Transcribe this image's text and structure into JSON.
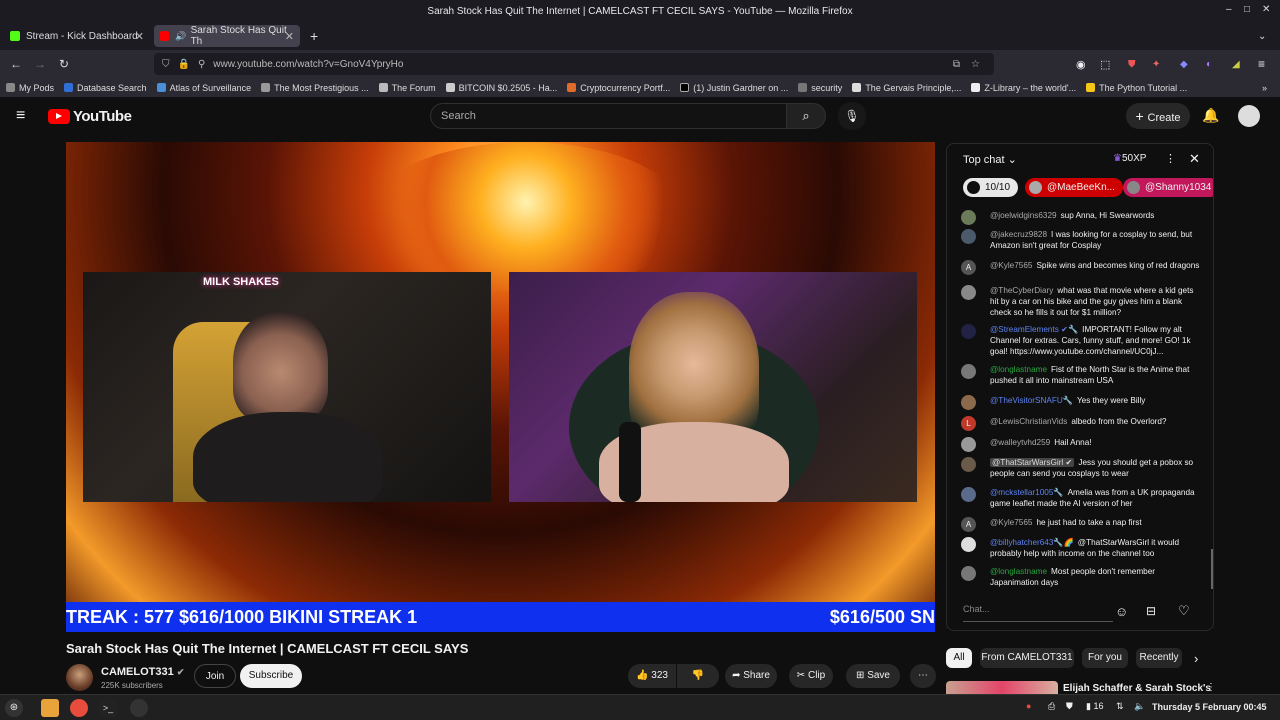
{
  "window": {
    "title": "Sarah Stock Has Quit The Internet | CAMELCAST FT CECIL SAYS - YouTube — Mozilla Firefox"
  },
  "tabs": [
    {
      "label": "Stream - Kick Dashboard",
      "fav_color": "#53fc18"
    },
    {
      "label": "Sarah Stock Has Quit Th",
      "fav_color": "#ff0000"
    }
  ],
  "nav": {
    "url": "www.youtube.com/watch?v=GnoV4YpryHo"
  },
  "bookmarks": [
    {
      "label": "My Pods",
      "color": "#888"
    },
    {
      "label": "Database Search",
      "color": "#2f6fd6"
    },
    {
      "label": "Atlas of Surveillance",
      "color": "#4a90d9"
    },
    {
      "label": "The Most Prestigious ...",
      "color": "#999"
    },
    {
      "label": "The Forum",
      "color": "#bbb"
    },
    {
      "label": "BITCOIN $0.2505 - Ha...",
      "color": "#ccc"
    },
    {
      "label": "Cryptocurrency Portf...",
      "color": "#e06b2a"
    },
    {
      "label": "(1) Justin Gardner on ...",
      "color": "#000"
    },
    {
      "label": "security",
      "color": "#777"
    },
    {
      "label": "The Gervais Principle,...",
      "color": "#ddd"
    },
    {
      "label": "Z-Library – the world'...",
      "color": "#eee"
    },
    {
      "label": "The Python Tutorial ...",
      "color": "#f5c518"
    }
  ],
  "youtube": {
    "logo_text": "YouTube",
    "search_placeholder": "Search",
    "create_label": "Create"
  },
  "video": {
    "ticker_left": "TREAK : 577 $616/1000 BIKINI STREAK 1",
    "ticker_right": "$616/500 SN",
    "cam1_sign": "MILK SHAKES",
    "title": "Sarah Stock Has Quit The Internet | CAMELCAST FT CECIL SAYS"
  },
  "channel": {
    "name": "CAMELOT331",
    "subscribers": "225K subscribers",
    "join_label": "Join",
    "subscribe_label": "Subscribe",
    "likes": "323",
    "share_label": "Share",
    "clip_label": "Clip",
    "save_label": "Save"
  },
  "chat": {
    "header": "Top chat",
    "xp": "50XP",
    "counter": "10/10",
    "pinned": [
      {
        "name": "@MaeBeeKn...",
        "color": "#cc0000"
      },
      {
        "name": "@Shanny1034",
        "color": "#c2185b"
      }
    ],
    "messages": [
      {
        "author": "@joelwidgins6329",
        "text": "sup Anna, Hi Swearwords",
        "type": "normal",
        "av": "#6b7b5a"
      },
      {
        "author": "@jakecruz9828",
        "text": "I was looking for a cosplay to send, but Amazon isn't great for Cosplay",
        "type": "normal",
        "av": "#4a5a6a"
      },
      {
        "author": "@Kyle7565",
        "text": "Spike wins and becomes king of red dragons",
        "type": "normal",
        "av": "#555555",
        "initial": "A"
      },
      {
        "author": "@TheCyberDiary",
        "text": "what was that movie where a kid gets hit by a car on his bike and the guy gives him a blank check so he fills it out for $1 million?",
        "type": "normal",
        "av": "#888888"
      },
      {
        "author": "@StreamElements ✔🔧",
        "text": "IMPORTANT! Follow my alt Channel for extras. Cars, funny stuff, and more! GO! 1k goal! https://www.youtube.com/channel/UC0jJ...",
        "type": "mod",
        "av": "#222244"
      },
      {
        "author": "@longlastname",
        "text": "Fist of the North Star is the Anime that pushed it all into mainstream USA",
        "type": "member",
        "av": "#777777"
      },
      {
        "author": "@TheVisitorSNAFU🔧",
        "text": "Yes they were Billy",
        "type": "mod",
        "av": "#8a6a4a"
      },
      {
        "author": "@LewisChristianVids",
        "text": "albedo from the Overlord?",
        "type": "normal",
        "av": "#c0392b",
        "initial": "L"
      },
      {
        "author": "@walleytvhd259",
        "text": "Hail Anna!",
        "type": "normal",
        "av": "#999999"
      },
      {
        "author": "@ThatStarWarsGirl ✔",
        "text": "Jess you should get a pobox so people can send you cosplays to wear",
        "type": "hl",
        "av": "#6a5a4a"
      },
      {
        "author": "@mckstellar1005🔧",
        "text": "Amelia was from a UK propaganda game leaflet made the AI version of her",
        "type": "mod",
        "av": "#5a6a8a"
      },
      {
        "author": "@Kyle7565",
        "text": "he just had to take a nap first",
        "type": "normal",
        "av": "#555555",
        "initial": "A"
      },
      {
        "author": "@billyhatcher643🔧🌈",
        "text": "@ThatStarWarsGirl it would probably help with income on the channel too",
        "type": "mod",
        "av": "#dddddd"
      },
      {
        "author": "@longlastname",
        "text": "Most people don't remember Japanimation days",
        "type": "member",
        "av": "#777777"
      }
    ],
    "input_placeholder": "Chat..."
  },
  "filters": [
    "All",
    "From CAMELOT331",
    "For you",
    "Recently"
  ],
  "suggested": {
    "title": "Elijah Schaffer & Sarah Stock's"
  },
  "taskbar": {
    "battery": "16",
    "clock": "Thursday  5 February 00:45"
  }
}
